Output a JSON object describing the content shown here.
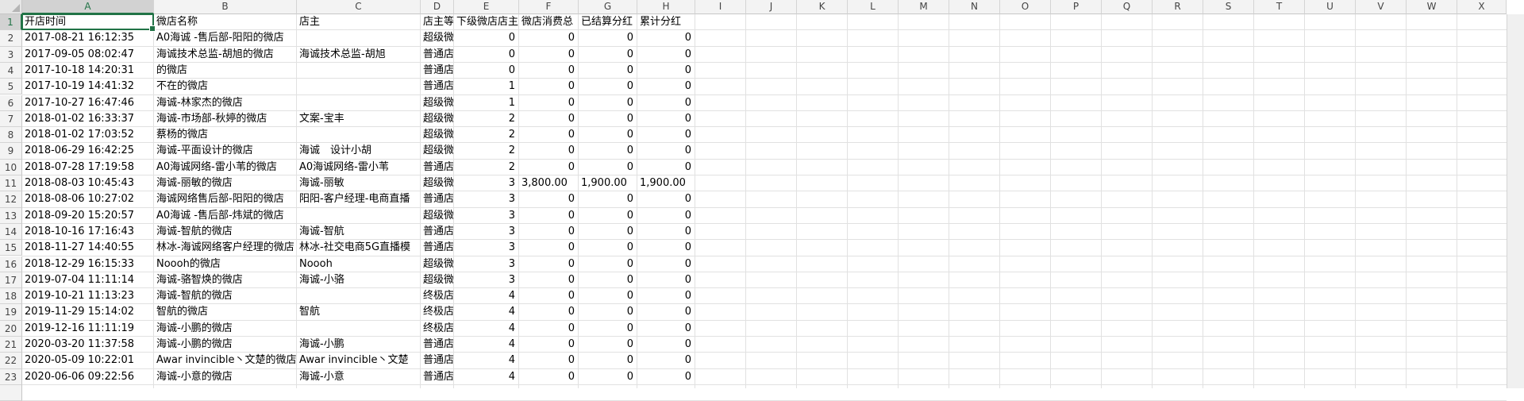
{
  "column_letters": [
    "A",
    "B",
    "C",
    "D",
    "E",
    "F",
    "G",
    "H",
    "I",
    "J",
    "K",
    "L",
    "M",
    "N",
    "O",
    "P",
    "Q",
    "R",
    "S",
    "T",
    "U",
    "V",
    "W",
    "X"
  ],
  "row_numbers": [
    "1",
    "2",
    "3",
    "4",
    "5",
    "6",
    "7",
    "8",
    "9",
    "10",
    "11",
    "12",
    "13",
    "14",
    "15",
    "16",
    "17",
    "18",
    "19",
    "20",
    "21",
    "22",
    "23"
  ],
  "header_row": [
    "开店时间",
    "微店名称",
    "店主",
    "店主等",
    "下级微店店主",
    "微店消费总",
    "已结算分红",
    "累计分红"
  ],
  "data_rows": [
    [
      "2017-08-21 16:12:35",
      "A0海诚 -售后部-阳阳的微店",
      "",
      "超级微",
      "0",
      "0",
      "0",
      "0"
    ],
    [
      "2017-09-05 08:02:47",
      "海诚技术总监-胡旭的微店",
      "海诚技术总监-胡旭",
      "普通店",
      "0",
      "0",
      "0",
      "0"
    ],
    [
      "2017-10-18 14:20:31",
      "的微店",
      "",
      "普通店",
      "0",
      "0",
      "0",
      "0"
    ],
    [
      "2017-10-19 14:41:32",
      "不在的微店",
      "",
      "普通店",
      "1",
      "0",
      "0",
      "0"
    ],
    [
      "2017-10-27 16:47:46",
      "海诚-林家杰的微店",
      "",
      "超级微",
      "1",
      "0",
      "0",
      "0"
    ],
    [
      "2018-01-02 16:33:37",
      "海诚-市场部-秋婷的微店",
      "文案-宝丰",
      "超级微",
      "2",
      "0",
      "0",
      "0"
    ],
    [
      "2018-01-02 17:03:52",
      "蔡杨的微店",
      "",
      "超级微",
      "2",
      "0",
      "0",
      "0"
    ],
    [
      "2018-06-29 16:42:25",
      "海诚-平面设计的微店",
      "海诚　设计小胡",
      "超级微",
      "2",
      "0",
      "0",
      "0"
    ],
    [
      "2018-07-28 17:19:58",
      "A0海诚网络-雷小苇的微店",
      "A0海诚网络-雷小苇",
      "普通店",
      "2",
      "0",
      "0",
      "0"
    ],
    [
      "2018-08-03 10:45:43",
      "海诚-丽敏的微店",
      "海诚-丽敏",
      "超级微",
      "3",
      "3,800.00",
      "1,900.00",
      "1,900.00"
    ],
    [
      "2018-08-06 10:27:02",
      "海诚网络售后部-阳阳的微店",
      "阳阳-客户经理-电商直播",
      "普通店",
      "3",
      "0",
      "0",
      "0"
    ],
    [
      "2018-09-20 15:20:57",
      "A0海诚 -售后部-炜斌的微店",
      "",
      "超级微",
      "3",
      "0",
      "0",
      "0"
    ],
    [
      "2018-10-16 17:16:43",
      "海诚-智航的微店",
      "海诚-智航",
      "普通店",
      "3",
      "0",
      "0",
      "0"
    ],
    [
      "2018-11-27 14:40:55",
      "林冰-海诚网络客户经理的微店",
      "林冰-社交电商5G直播模",
      "普通店",
      "3",
      "0",
      "0",
      "0"
    ],
    [
      "2018-12-29 16:15:33",
      "Noooh的微店",
      "Noooh",
      "超级微",
      "3",
      "0",
      "0",
      "0"
    ],
    [
      "2019-07-04 11:11:14",
      "海诚-骆智焕的微店",
      "海诚-小骆",
      "超级微",
      "3",
      "0",
      "0",
      "0"
    ],
    [
      "2019-10-21 11:13:23",
      "海诚-智航的微店",
      "",
      "终极店",
      "4",
      "0",
      "0",
      "0"
    ],
    [
      "2019-11-29 15:14:02",
      "智航的微店",
      "智航",
      "终极店",
      "4",
      "0",
      "0",
      "0"
    ],
    [
      "2019-12-16 11:11:19",
      "海诚-小鹏的微店",
      "",
      "终极店",
      "4",
      "0",
      "0",
      "0"
    ],
    [
      "2020-03-20 11:37:58",
      "海诚-小鹏的微店",
      "海诚-小鹏",
      "普通店",
      "4",
      "0",
      "0",
      "0"
    ],
    [
      "2020-05-09 10:22:01",
      "Awar invincible丶文楚的微店",
      "Awar invincible丶文楚",
      "普通店",
      "4",
      "0",
      "0",
      "0"
    ],
    [
      "2020-06-06 09:22:56",
      "海诚-小意的微店",
      "海诚-小意",
      "普通店",
      "4",
      "0",
      "0",
      "0"
    ]
  ],
  "colors": {
    "accent": "#217346",
    "gridline": "#e1e1e1",
    "header_bg": "#f3f3f3"
  }
}
